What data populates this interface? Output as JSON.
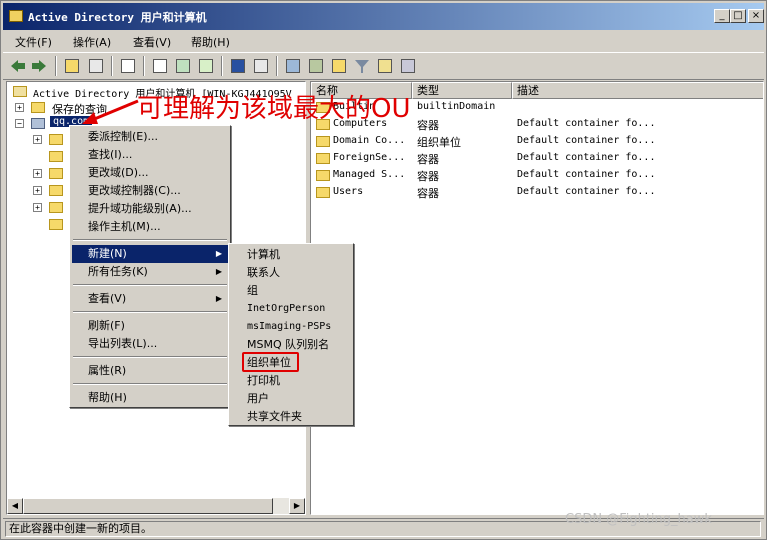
{
  "window": {
    "title": "Active Directory 用户和计算机",
    "minimize": "_",
    "maximize": "□",
    "close": "×"
  },
  "menubar": [
    "文件(F)",
    "操作(A)",
    "查看(V)",
    "帮助(H)"
  ],
  "toolbar": {
    "icons": [
      "back-icon",
      "forward-icon",
      "up-icon",
      "show-hide-tree-icon",
      "properties-icon",
      "export-icon",
      "refresh-icon",
      "export-list-icon",
      "help-icon",
      "mmc-icon",
      "new-user-icon",
      "new-group-icon",
      "new-ou-icon",
      "filter-icon",
      "find-icon",
      "add-to-group-icon"
    ]
  },
  "tree": {
    "root": "Active Directory 用户和计算机 [WIN-KGJ441Q95V",
    "saved_queries": "保存的查询",
    "domain": "qq.com"
  },
  "list": {
    "columns": [
      "名称",
      "类型",
      "描述"
    ],
    "rows": [
      {
        "name": "Builtin",
        "type": "builtinDomain",
        "desc": ""
      },
      {
        "name": "Computers",
        "type": "容器",
        "desc": "Default container fo..."
      },
      {
        "name": "Domain Co...",
        "type": "组织单位",
        "desc": "Default container fo..."
      },
      {
        "name": "ForeignSe...",
        "type": "容器",
        "desc": "Default container fo..."
      },
      {
        "name": "Managed S...",
        "type": "容器",
        "desc": "Default container fo..."
      },
      {
        "name": "Users",
        "type": "容器",
        "desc": "Default container fo..."
      }
    ]
  },
  "context_menu": {
    "items": [
      "委派控制(E)...",
      "查找(I)...",
      "更改域(D)...",
      "更改域控制器(C)...",
      "提升域功能级别(A)...",
      "操作主机(M)...",
      "新建(N)",
      "所有任务(K)",
      "查看(V)",
      "刷新(F)",
      "导出列表(L)...",
      "属性(R)",
      "帮助(H)"
    ]
  },
  "submenu": {
    "items": [
      "计算机",
      "联系人",
      "组",
      "InetOrgPerson",
      "msImaging-PSPs",
      "MSMQ 队列别名",
      "组织单位",
      "打印机",
      "用户",
      "共享文件夹"
    ]
  },
  "annotation": "可理解为该域最大的OU",
  "status": "在此容器中创建一新的项目。",
  "watermark": "CSDN @Fighting_hawk",
  "colors": {
    "accent": "#0a246a",
    "annotation": "#e00000"
  }
}
